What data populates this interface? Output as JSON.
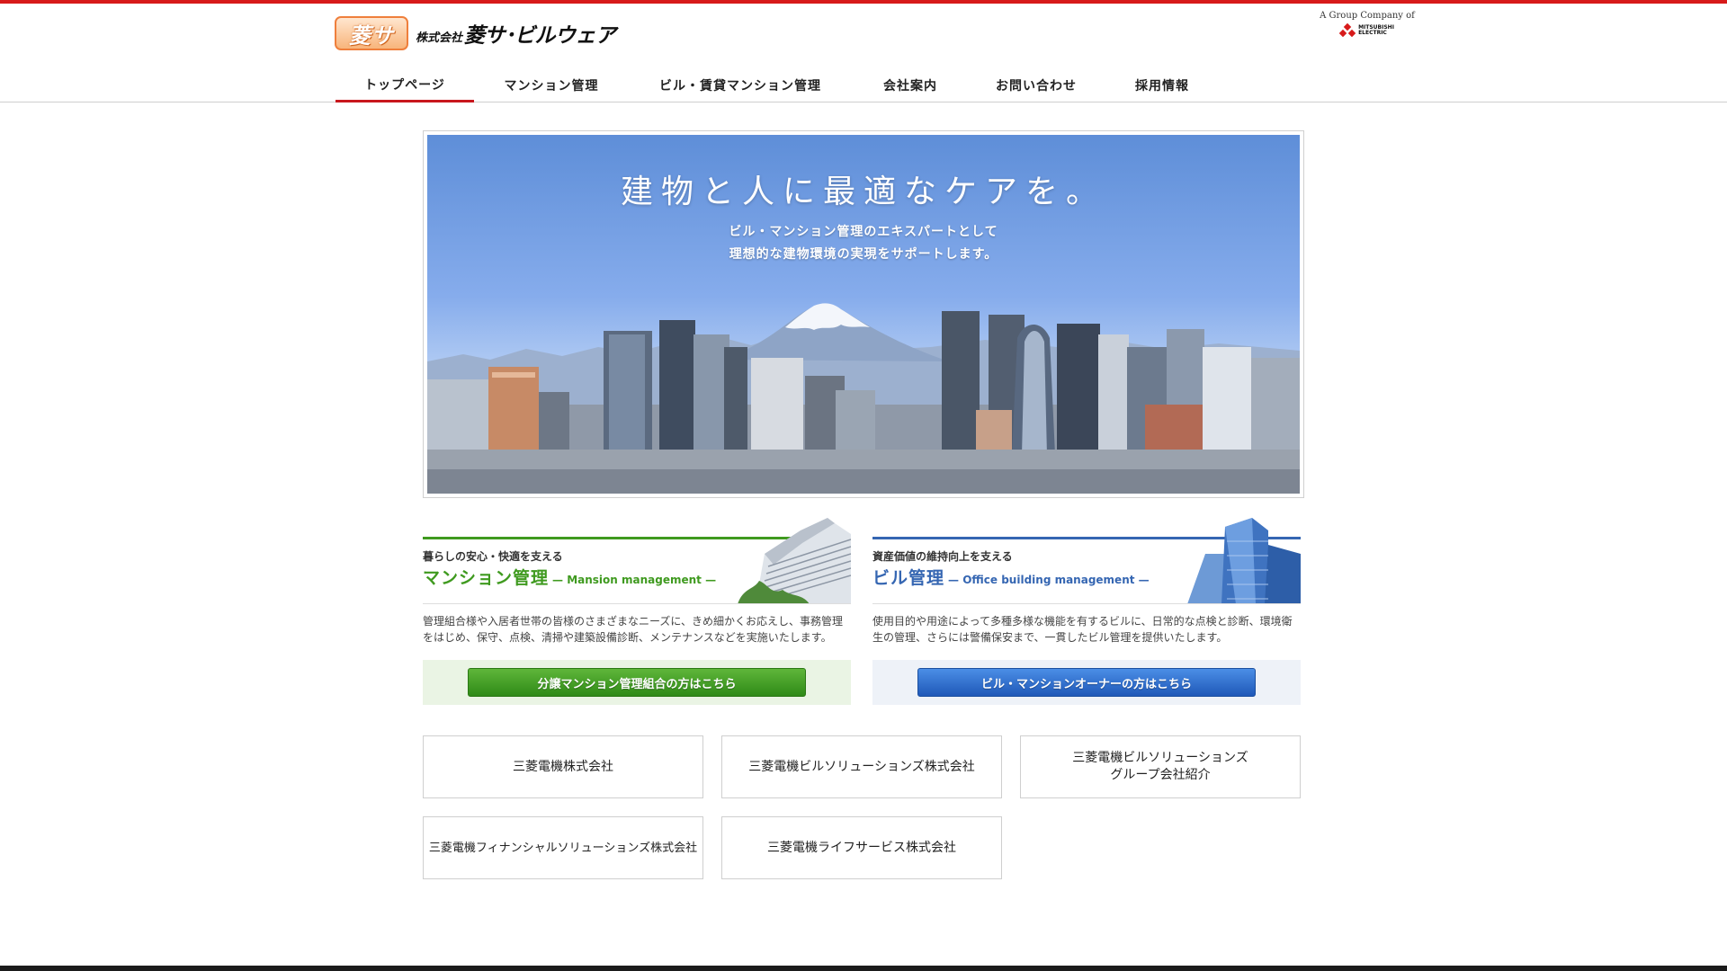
{
  "header": {
    "logo_mark": "菱サ",
    "logo_kabushiki": "株式会社",
    "logo_company": "菱サ･ビルウェア",
    "group_text": "A Group Company of",
    "group_brand_1": "MITSUBISHI",
    "group_brand_2": "ELECTRIC"
  },
  "nav": {
    "items": [
      {
        "label": "トップページ",
        "active": true
      },
      {
        "label": "マンション管理"
      },
      {
        "label": "ビル・賃貸マンション管理"
      },
      {
        "label": "会社案内"
      },
      {
        "label": "お問い合わせ"
      },
      {
        "label": "採用情報"
      }
    ]
  },
  "hero": {
    "title": "建物と人に最適なケアを。",
    "subtitle_1": "ビル・マンション管理のエキスパートとして",
    "subtitle_2": "理想的な建物環境の実現をサポートします。"
  },
  "services": [
    {
      "kicker": "暮らしの安心・快適を支える",
      "title": "マンション管理",
      "title_en": "— Mansion management —",
      "desc": "管理組合様や入居者世帯の皆様のさまざまなニーズに、きめ細かくお応えし、事務管理をはじめ、保守、点検、清掃や建築設備診断、メンテナンスなどを実施いたします。",
      "button": "分譲マンション管理組合の方はこちら",
      "color": "#3f9a1f",
      "box_bg": "#eaf4e4"
    },
    {
      "kicker": "資産価値の維持向上を支える",
      "title": "ビル管理",
      "title_en": "— Office building management —",
      "desc": "使用目的や用途によって多種多様な機能を有するビルに、日常的な点検と診断、環境衛生の管理、さらには警備保安まで、一貫したビル管理を提供いたします。",
      "button": "ビル・マンションオーナーの方はこちら",
      "color": "#2d67c4",
      "box_bg": "#eef2f8"
    }
  ],
  "related": [
    {
      "label": "三菱電機株式会社"
    },
    {
      "label": "三菱電機ビルソリューションズ株式会社"
    },
    {
      "label": "三菱電機ビルソリューションズ\nグループ会社紹介"
    },
    {
      "label": "三菱電機フィナンシャルソリューションズ株式会社"
    },
    {
      "label": "三菱電機ライフサービス株式会社"
    }
  ],
  "colors": {
    "accent_red": "#d71a1a",
    "nav_active": "#c8161d",
    "logo_orange": "#ef7f3c"
  },
  "icons": [
    "mitsubishi-diamonds-icon"
  ]
}
